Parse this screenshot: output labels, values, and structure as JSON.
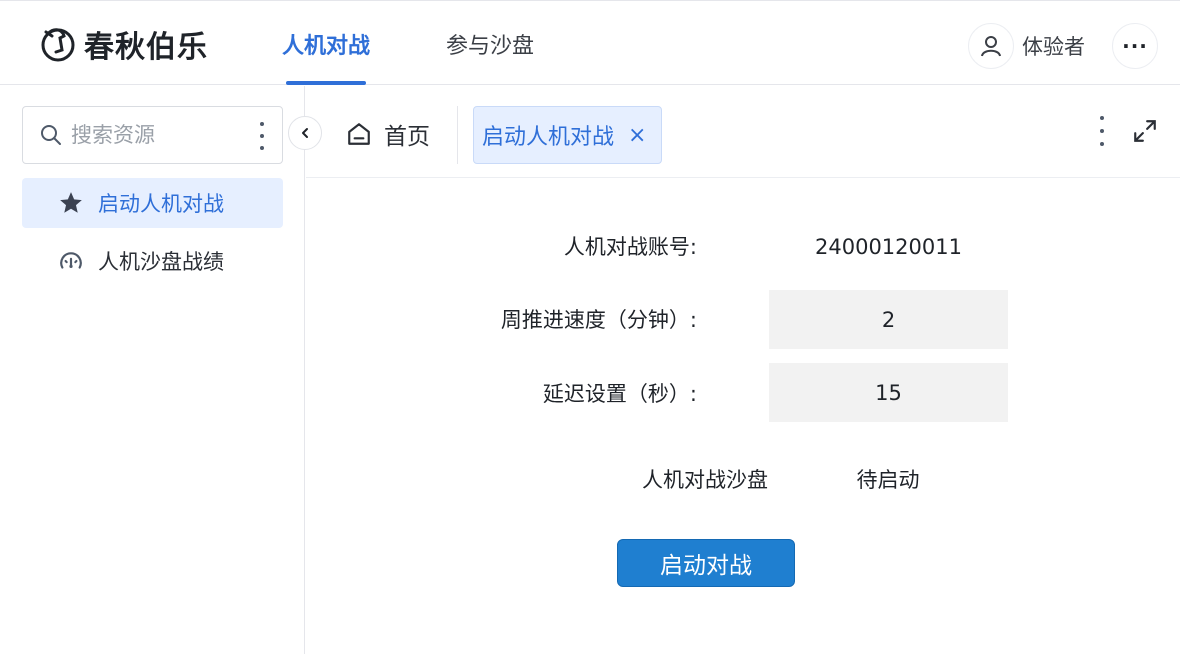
{
  "header": {
    "logo_text": "春秋伯乐",
    "nav_tabs": [
      {
        "label": "人机对战",
        "active": true
      },
      {
        "label": "参与沙盘",
        "active": false
      }
    ],
    "user_name": "体验者",
    "more_label": "···"
  },
  "sidebar": {
    "search": {
      "placeholder": "搜索资源",
      "value": ""
    },
    "items": [
      {
        "label": "启动人机对战",
        "icon": "star-icon",
        "active": true
      },
      {
        "label": "人机沙盘战绩",
        "icon": "dashboard-icon",
        "active": false
      }
    ]
  },
  "tabs": {
    "home_label": "首页",
    "open_tab_label": "启动人机对战",
    "close_symbol": "×"
  },
  "form": {
    "account_label": "人机对战账号:",
    "account_value": "24000120011",
    "speed_label": "周推进速度（分钟）:",
    "speed_value": "2",
    "delay_label": "延迟设置（秒）:",
    "delay_value": "15",
    "status_label": "人机对战沙盘",
    "status_value": "待启动",
    "start_button": "启动对战"
  },
  "colors": {
    "accent": "#2f6fd8",
    "button": "#1f7fd0",
    "active_bg": "#e6efff"
  }
}
